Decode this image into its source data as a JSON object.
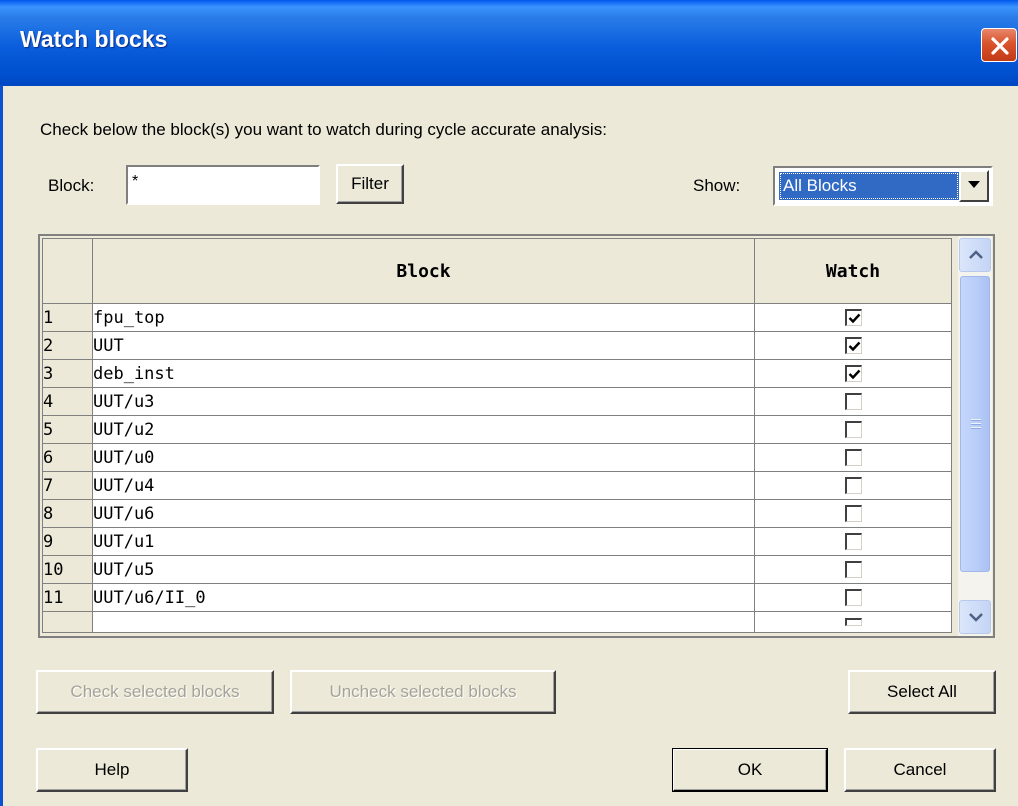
{
  "window": {
    "title": "Watch blocks"
  },
  "instruction": "Check below the block(s) you want to watch during cycle accurate analysis:",
  "filter": {
    "label": "Block:",
    "value": "*",
    "button": "Filter"
  },
  "show": {
    "label": "Show:",
    "selected": "All Blocks"
  },
  "grid": {
    "columns": [
      "Block",
      "Watch"
    ],
    "rows": [
      {
        "n": "1",
        "block": "fpu_top",
        "watch": true
      },
      {
        "n": "2",
        "block": "UUT",
        "watch": true
      },
      {
        "n": "3",
        "block": "deb_inst",
        "watch": true
      },
      {
        "n": "4",
        "block": "UUT/u3",
        "watch": false
      },
      {
        "n": "5",
        "block": "UUT/u2",
        "watch": false
      },
      {
        "n": "6",
        "block": "UUT/u0",
        "watch": false
      },
      {
        "n": "7",
        "block": "UUT/u4",
        "watch": false
      },
      {
        "n": "8",
        "block": "UUT/u6",
        "watch": false
      },
      {
        "n": "9",
        "block": "UUT/u1",
        "watch": false
      },
      {
        "n": "10",
        "block": "UUT/u5",
        "watch": false
      },
      {
        "n": "11",
        "block": "UUT/u6/II_0",
        "watch": false
      }
    ]
  },
  "buttons": {
    "check_selected": "Check selected blocks",
    "uncheck_selected": "Uncheck selected blocks",
    "select_all": "Select All",
    "help": "Help",
    "ok": "OK",
    "cancel": "Cancel"
  },
  "colors": {
    "title_bar": "#0a5ddc",
    "dialog_bg": "#ece9d8",
    "selection": "#316ac5"
  }
}
